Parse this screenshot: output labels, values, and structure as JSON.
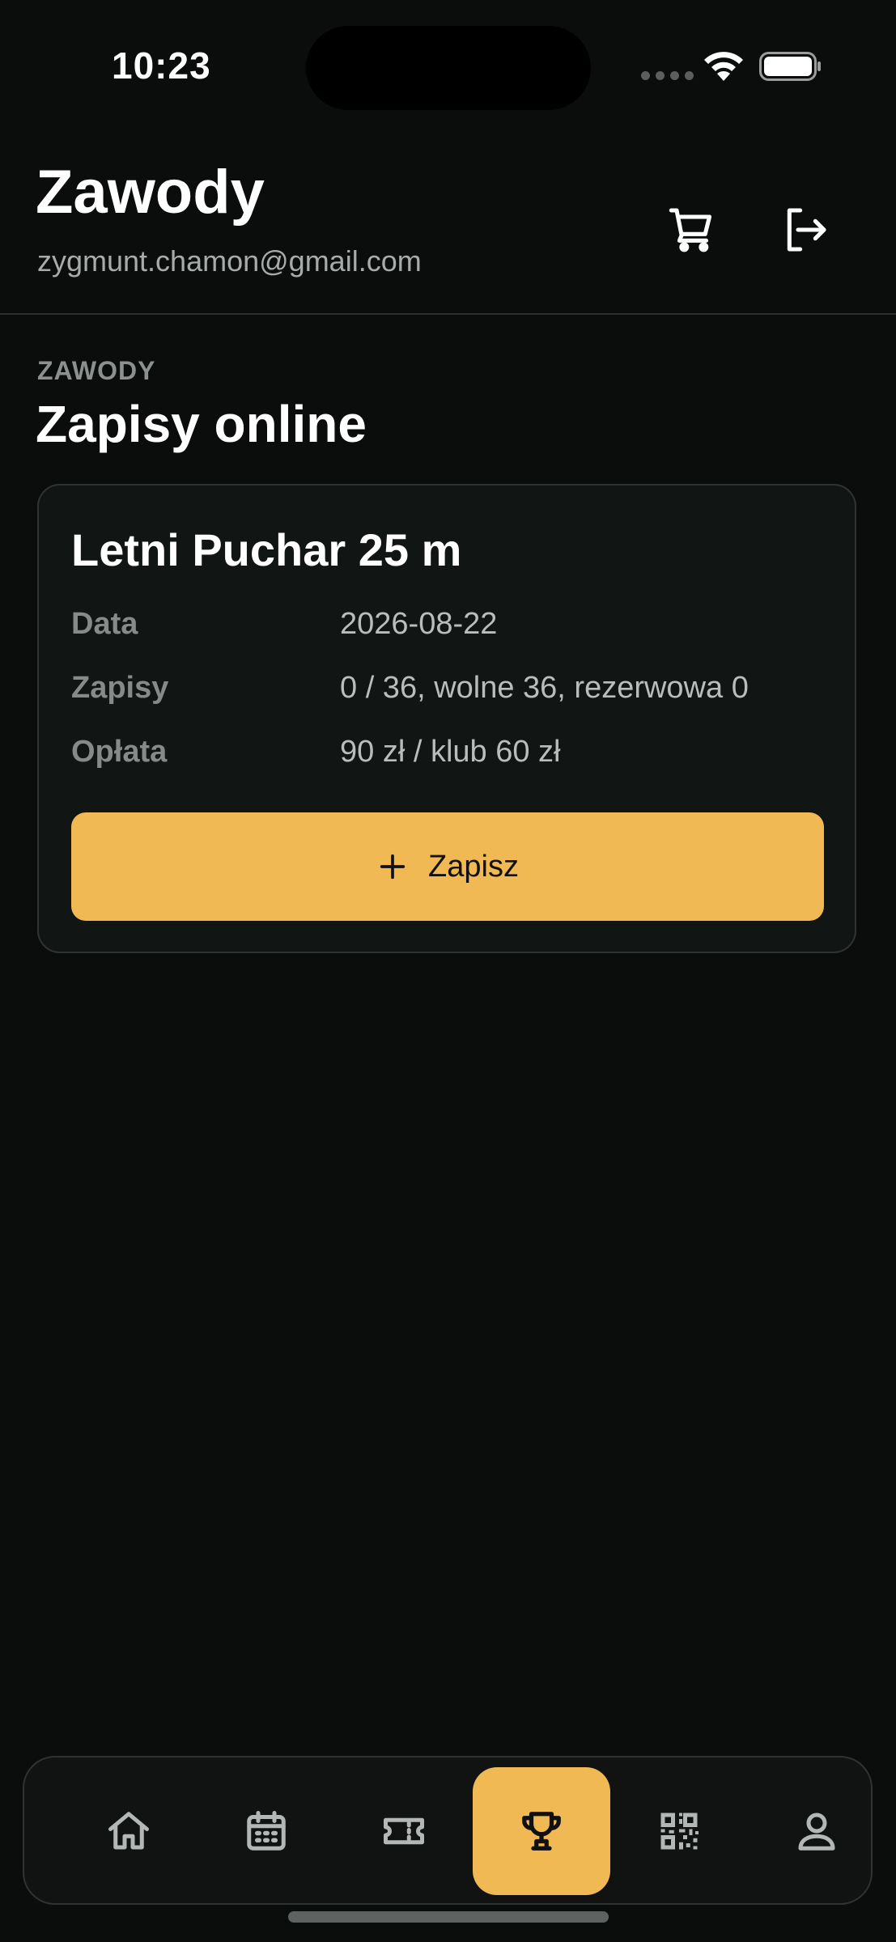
{
  "status_bar": {
    "time": "10:23",
    "icons": [
      "cellular-signal-icon",
      "wifi-icon",
      "battery-icon"
    ]
  },
  "header": {
    "title": "Zawody",
    "email": "zygmunt.chamon@gmail.com",
    "actions": [
      {
        "name": "cart",
        "icon": "cart-icon"
      },
      {
        "name": "logout",
        "icon": "logout-icon"
      }
    ]
  },
  "section": {
    "eyebrow": "ZAWODY",
    "title": "Zapisy online"
  },
  "event": {
    "name": "Letni Puchar 25 m",
    "rows": [
      {
        "label": "Data",
        "value": "2026-08-22"
      },
      {
        "label": "Zapisy",
        "value": "0 / 36, wolne 36, rezerwowa 0"
      },
      {
        "label": "Opłata",
        "value": "90 zł / klub 60 zł"
      }
    ],
    "signup_button": {
      "label": "Zapisz",
      "icon": "plus-icon"
    }
  },
  "tab_bar": {
    "active_tab": "competitions",
    "tabs": [
      {
        "name": "home",
        "icon": "home-icon"
      },
      {
        "name": "calendar",
        "icon": "calendar-icon"
      },
      {
        "name": "tickets",
        "icon": "ticket-icon"
      },
      {
        "name": "competitions",
        "icon": "trophy-icon"
      },
      {
        "name": "qr-code",
        "icon": "qr-code-icon"
      },
      {
        "name": "profile",
        "icon": "user-icon"
      }
    ]
  },
  "colors": {
    "background": "#0b0d0c",
    "card": "#111513",
    "accent": "#f1b954",
    "muted_text": "#868a88"
  }
}
